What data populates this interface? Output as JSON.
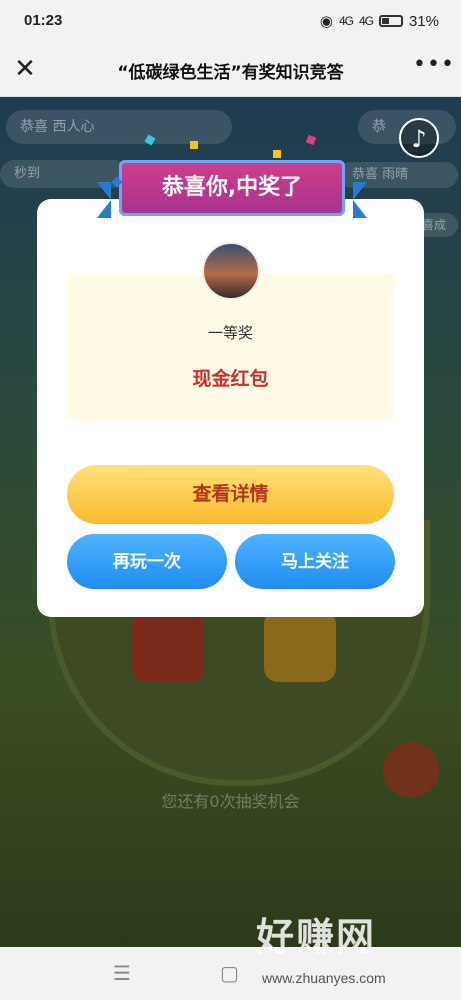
{
  "status_bar": {
    "time": "01:23",
    "signal1": "4G",
    "signal2": "4G",
    "battery": "31%"
  },
  "nav": {
    "title": "“低碳绿色生活”有奖知识竞答",
    "close_icon": "close-icon",
    "more_icon": "more-icon"
  },
  "background": {
    "pill_left": "恭喜 西人心",
    "pill_right": "恭",
    "marquee_left": "秒到",
    "marquee_right": "恭喜 雨晴",
    "marquee_right2": "恭喜成",
    "tip_text": "您还有0次抽奖机会"
  },
  "modal": {
    "banner": "恭喜你,中奖了",
    "prize_level": "一等奖",
    "prize_name": "现金红包",
    "detail_button": "查看详情",
    "replay_button": "再玩一次",
    "follow_button": "马上关注"
  },
  "watermark": {
    "text": "好赚网",
    "url": "www.zhuanyes.com"
  },
  "colors": {
    "accent_red": "#c9302c",
    "gold": "#fbb92e",
    "blue": "#1e8cf0",
    "banner": "#d23d8a"
  }
}
